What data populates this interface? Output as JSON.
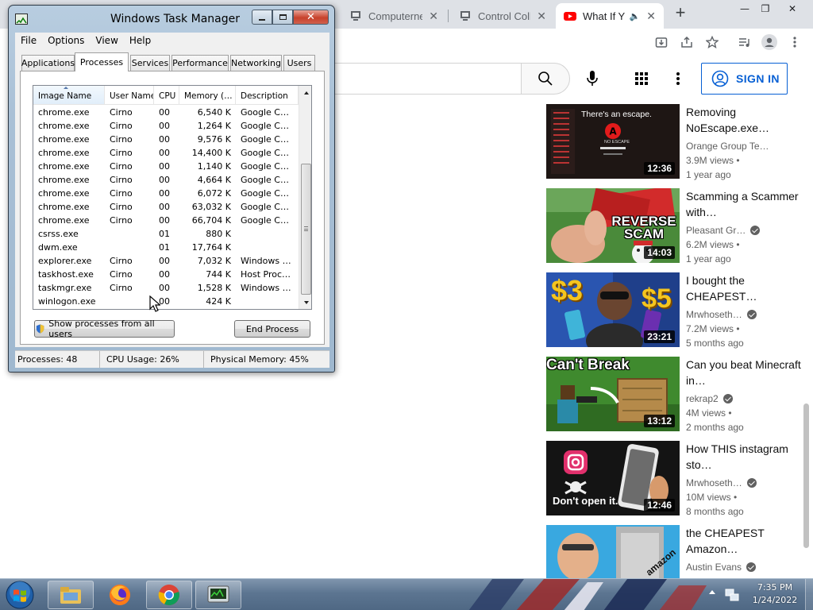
{
  "browser": {
    "tabs": [
      {
        "title": "Computerne",
        "active": false
      },
      {
        "title": "Control Colla",
        "active": false
      },
      {
        "title": "What If Y",
        "active": true
      }
    ],
    "new_tab_label": "+",
    "window_controls": {
      "minimize": "—",
      "restore": "❐",
      "close": "✕"
    }
  },
  "youtube": {
    "sign_in_label": "SIGN IN",
    "videos": [
      {
        "title": "Removing NoEscape.exe…",
        "channel": "Orange Group Te…",
        "verified": false,
        "views": "3.9M views •",
        "ago": "1 year ago",
        "duration": "12:36",
        "thumb_text": "There's an escape.",
        "thumb_subtext": "NO ESCAPE"
      },
      {
        "title": "Scamming a Scammer with…",
        "channel": "Pleasant Gr…",
        "verified": true,
        "views": "6.2M views •",
        "ago": "1 year ago",
        "duration": "14:03",
        "thumb_text": "REVERSE SCAM"
      },
      {
        "title": "I bought the CHEAPEST…",
        "channel": "Mrwhoseth…",
        "verified": true,
        "views": "7.2M views •",
        "ago": "5 months ago",
        "duration": "23:21",
        "thumb_text_left": "$3",
        "thumb_text_right": "$5"
      },
      {
        "title": "Can you beat Minecraft in…",
        "channel": "rekrap2",
        "verified": true,
        "views": "4M views •",
        "ago": "2 months ago",
        "duration": "13:12",
        "thumb_text": "Can't Break"
      },
      {
        "title": "How THIS instagram sto…",
        "channel": "Mrwhoseth…",
        "verified": true,
        "views": "10M views •",
        "ago": "8 months ago",
        "duration": "12:46",
        "thumb_text": "Don't open it."
      },
      {
        "title": "the CHEAPEST Amazon…",
        "channel": "Austin Evans",
        "verified": true,
        "views": "",
        "ago": "",
        "duration": "",
        "thumb_text": "amazon"
      }
    ]
  },
  "taskmgr": {
    "title": "Windows Task Manager",
    "menus": [
      "File",
      "Options",
      "View",
      "Help"
    ],
    "tabs": [
      "Applications",
      "Processes",
      "Services",
      "Performance",
      "Networking",
      "Users"
    ],
    "active_tab": "Processes",
    "columns": [
      "Image Name",
      "User Name",
      "CPU",
      "Memory (…",
      "Description"
    ],
    "processes": [
      [
        "chrome.exe",
        "Cirno",
        "00",
        "6,540 K",
        "Google C…"
      ],
      [
        "chrome.exe",
        "Cirno",
        "00",
        "1,264 K",
        "Google C…"
      ],
      [
        "chrome.exe",
        "Cirno",
        "00",
        "9,576 K",
        "Google C…"
      ],
      [
        "chrome.exe",
        "Cirno",
        "00",
        "14,400 K",
        "Google C…"
      ],
      [
        "chrome.exe",
        "Cirno",
        "00",
        "1,140 K",
        "Google C…"
      ],
      [
        "chrome.exe",
        "Cirno",
        "00",
        "4,664 K",
        "Google C…"
      ],
      [
        "chrome.exe",
        "Cirno",
        "00",
        "6,072 K",
        "Google C…"
      ],
      [
        "chrome.exe",
        "Cirno",
        "00",
        "63,032 K",
        "Google C…"
      ],
      [
        "chrome.exe",
        "Cirno",
        "00",
        "66,704 K",
        "Google C…"
      ],
      [
        "csrss.exe",
        "",
        "01",
        "880 K",
        ""
      ],
      [
        "dwm.exe",
        "",
        "01",
        "17,764 K",
        ""
      ],
      [
        "explorer.exe",
        "Cirno",
        "00",
        "7,032 K",
        "Windows …"
      ],
      [
        "taskhost.exe",
        "Cirno",
        "00",
        "744 K",
        "Host Proc…"
      ],
      [
        "taskmgr.exe",
        "Cirno",
        "00",
        "1,528 K",
        "Windows …"
      ],
      [
        "winlogon.exe",
        "",
        "00",
        "424 K",
        ""
      ]
    ],
    "show_all_label": "Show processes from all users",
    "end_process_label": "End Process",
    "status": {
      "processes": "Processes: 48",
      "cpu": "CPU Usage: 26%",
      "memory": "Physical Memory: 45%"
    }
  },
  "taskbar": {
    "clock_time": "7:35 PM",
    "clock_date": "1/24/2022",
    "pinned": [
      "explorer-icon",
      "firefox-icon",
      "chrome-icon",
      "taskmgr-icon"
    ]
  },
  "colors": {
    "yt_blue": "#065fd4",
    "yt_red": "#ff0000",
    "win_close": "#c7412b",
    "taskbar": "#5c7591"
  }
}
